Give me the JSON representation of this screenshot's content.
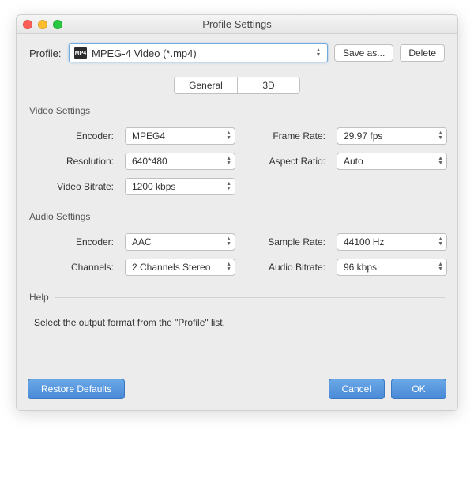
{
  "window": {
    "title": "Profile Settings"
  },
  "profile": {
    "label": "Profile:",
    "value": "MPEG-4 Video (*.mp4)",
    "save_as": "Save as...",
    "delete": "Delete"
  },
  "tabs": {
    "general": "General",
    "three_d": "3D"
  },
  "video": {
    "header": "Video Settings",
    "encoder_label": "Encoder:",
    "encoder": "MPEG4",
    "resolution_label": "Resolution:",
    "resolution": "640*480",
    "bitrate_label": "Video Bitrate:",
    "bitrate": "1200 kbps",
    "frame_rate_label": "Frame Rate:",
    "frame_rate": "29.97 fps",
    "aspect_label": "Aspect Ratio:",
    "aspect": "Auto"
  },
  "audio": {
    "header": "Audio Settings",
    "encoder_label": "Encoder:",
    "encoder": "AAC",
    "channels_label": "Channels:",
    "channels": "2 Channels Stereo",
    "sample_label": "Sample Rate:",
    "sample": "44100 Hz",
    "bitrate_label": "Audio Bitrate:",
    "bitrate": "96 kbps"
  },
  "help": {
    "header": "Help",
    "text": "Select the output format from the \"Profile\" list."
  },
  "footer": {
    "restore": "Restore Defaults",
    "cancel": "Cancel",
    "ok": "OK"
  }
}
